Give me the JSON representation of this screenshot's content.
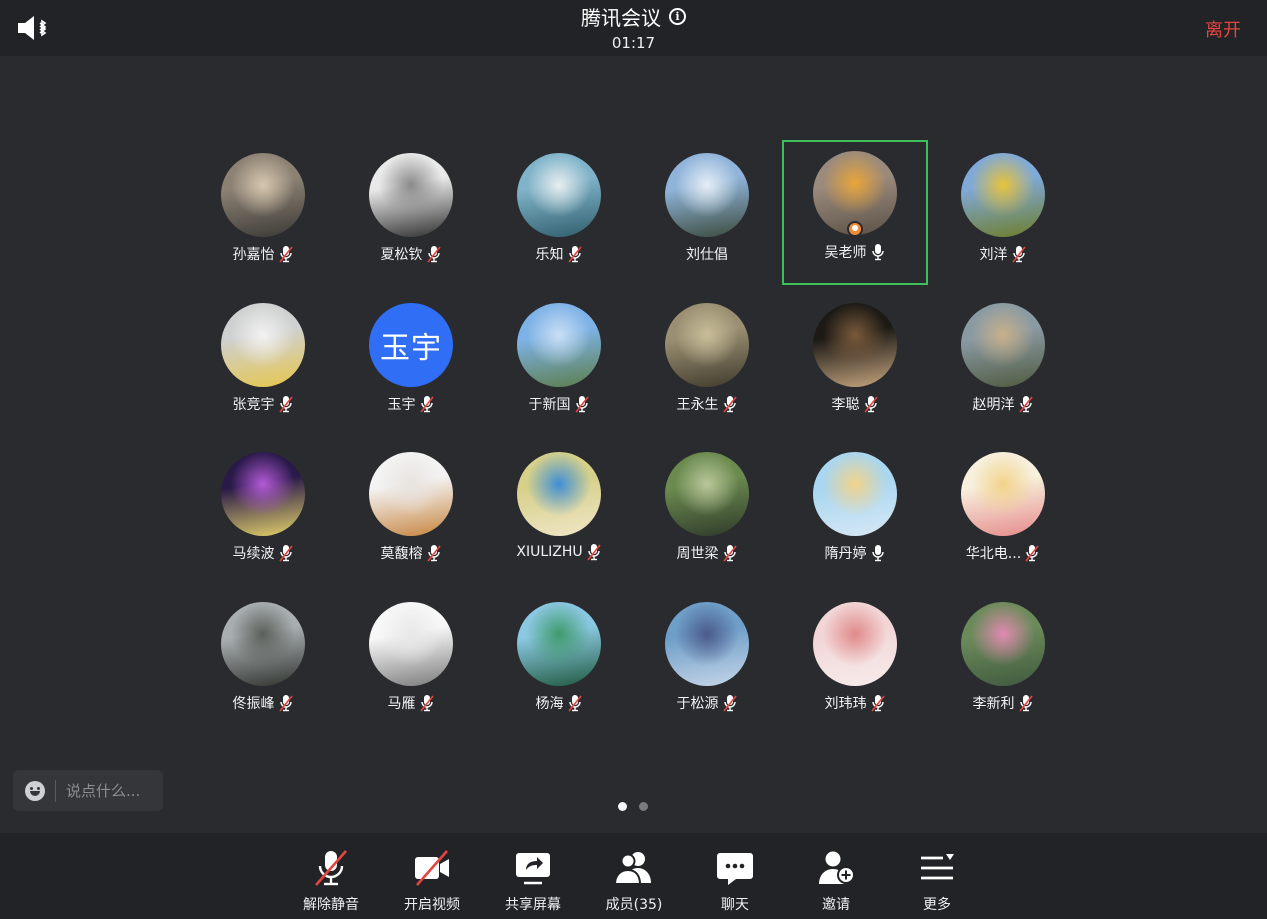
{
  "header": {
    "title": "腾讯会议",
    "timer": "01:17",
    "leave_label": "离开"
  },
  "participants": [
    {
      "name": "孙嘉怡",
      "mic": "muted",
      "avatar": {
        "type": "photo",
        "colors": [
          "#8c8173",
          "#d7c7b0",
          "#3b3a36"
        ]
      }
    },
    {
      "name": "夏松钦",
      "mic": "muted",
      "avatar": {
        "type": "photo",
        "colors": [
          "#e9e9e9",
          "#8a8a8a",
          "#2e2e2e"
        ]
      }
    },
    {
      "name": "乐知",
      "mic": "muted",
      "avatar": {
        "type": "photo",
        "colors": [
          "#7fb3c9",
          "#e8eef0",
          "#2f5d6b"
        ]
      }
    },
    {
      "name": "刘仕倡",
      "mic": "none",
      "avatar": {
        "type": "photo",
        "colors": [
          "#8fb3d9",
          "#e5eef5",
          "#3a4a3a"
        ]
      }
    },
    {
      "name": "吴老师",
      "mic": "on",
      "host": true,
      "avatar": {
        "type": "photo",
        "colors": [
          "#9a8a7c",
          "#e8a53a",
          "#5b5147"
        ]
      }
    },
    {
      "name": "刘洋",
      "mic": "muted",
      "avatar": {
        "type": "photo",
        "colors": [
          "#7fa9d6",
          "#e8c23a",
          "#6e7d2a"
        ]
      }
    },
    {
      "name": "张竞宇",
      "mic": "muted",
      "avatar": {
        "type": "photo",
        "colors": [
          "#cfd0d0",
          "#f2f2f2",
          "#e6c64b"
        ]
      }
    },
    {
      "name": "玉宇",
      "mic": "muted",
      "avatar": {
        "type": "text",
        "text": "玉宇"
      }
    },
    {
      "name": "于新国",
      "mic": "muted",
      "avatar": {
        "type": "photo",
        "colors": [
          "#7eb2e6",
          "#c9dff5",
          "#5b7d4a"
        ]
      }
    },
    {
      "name": "王永生",
      "mic": "muted",
      "avatar": {
        "type": "photo",
        "colors": [
          "#9a8f72",
          "#c9bd99",
          "#3f3a2c"
        ]
      }
    },
    {
      "name": "李聪",
      "mic": "muted",
      "avatar": {
        "type": "photo",
        "colors": [
          "#1d1a16",
          "#7a5a3a",
          "#c8a780"
        ]
      }
    },
    {
      "name": "赵明洋",
      "mic": "muted",
      "avatar": {
        "type": "photo",
        "colors": [
          "#8a9aa3",
          "#c7b08a",
          "#4f5a3f"
        ]
      }
    },
    {
      "name": "马续波",
      "mic": "muted",
      "avatar": {
        "type": "photo",
        "colors": [
          "#2a1a4a",
          "#b35ad6",
          "#e6d56a"
        ]
      }
    },
    {
      "name": "莫馥榕",
      "mic": "muted",
      "avatar": {
        "type": "photo",
        "colors": [
          "#f3f3f3",
          "#e8e3de",
          "#c7843f"
        ]
      }
    },
    {
      "name": "XIULIZHU",
      "mic": "muted",
      "avatar": {
        "type": "photo",
        "colors": [
          "#d6d08a",
          "#3f8fd6",
          "#f0e6c7"
        ]
      }
    },
    {
      "name": "周世梁",
      "mic": "muted",
      "avatar": {
        "type": "photo",
        "colors": [
          "#6b8a4f",
          "#b9c79a",
          "#2f3a2a"
        ]
      }
    },
    {
      "name": "隋丹婷",
      "mic": "on",
      "avatar": {
        "type": "photo",
        "colors": [
          "#a9d6f0",
          "#f2d38a",
          "#d6e8f5"
        ]
      }
    },
    {
      "name": "华北电...",
      "mic": "muted",
      "avatar": {
        "type": "photo",
        "colors": [
          "#f7f0dd",
          "#f2d38a",
          "#e58a8a"
        ]
      }
    },
    {
      "name": "佟振峰",
      "mic": "muted",
      "avatar": {
        "type": "photo",
        "colors": [
          "#a9aeb0",
          "#5a5f5a",
          "#2f332f"
        ]
      }
    },
    {
      "name": "马雁",
      "mic": "muted",
      "avatar": {
        "type": "photo",
        "colors": [
          "#f7f7f7",
          "#e8e8e8",
          "#7a7a7a"
        ]
      }
    },
    {
      "name": "杨海",
      "mic": "muted",
      "avatar": {
        "type": "photo",
        "colors": [
          "#8ac7e0",
          "#3f9a6b",
          "#1f5a3f"
        ]
      }
    },
    {
      "name": "于松源",
      "mic": "muted",
      "avatar": {
        "type": "photo",
        "colors": [
          "#6f9fc9",
          "#4a5a8a",
          "#c7d6e8"
        ]
      }
    },
    {
      "name": "刘玮玮",
      "mic": "muted",
      "avatar": {
        "type": "photo",
        "colors": [
          "#f2d6d6",
          "#e08a8a",
          "#f7ecec"
        ]
      }
    },
    {
      "name": "李新利",
      "mic": "muted",
      "avatar": {
        "type": "photo",
        "colors": [
          "#6b8a5a",
          "#e08ab0",
          "#3f5a3f"
        ]
      }
    }
  ],
  "chat": {
    "placeholder": "说点什么..."
  },
  "pager": {
    "pages": 2,
    "current": 1
  },
  "toolbar": {
    "unmute_label": "解除静音",
    "video_label": "开启视频",
    "share_label": "共享屏幕",
    "members_label": "成员(35)",
    "chat_label": "聊天",
    "invite_label": "邀请",
    "more_label": "更多"
  },
  "colors": {
    "background": "#2a2b2f",
    "bar": "#222326",
    "leave": "#e5453f",
    "active_speaker": "#3fbf5c",
    "text_avatar": "#2f6ef5",
    "mute_slash": "#e5453f"
  }
}
